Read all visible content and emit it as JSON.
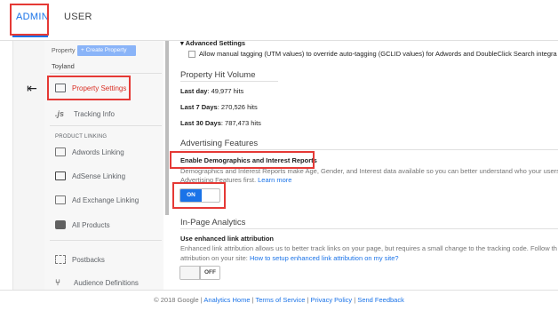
{
  "tabs": {
    "admin": "ADMIN",
    "user": "USER"
  },
  "property": {
    "label": "Property",
    "create_button": "+ Create Property",
    "name": "Toyland"
  },
  "nav": {
    "items": [
      {
        "label": "Property Settings",
        "icon": "property-settings-icon",
        "active": true
      },
      {
        "label": "Tracking Info",
        "icon": "js-icon",
        "active": false
      }
    ],
    "section_header": "PRODUCT LINKING",
    "linking": [
      {
        "label": "Adwords Linking",
        "icon": "adwords-icon"
      },
      {
        "label": "AdSense Linking",
        "icon": "adsense-icon"
      },
      {
        "label": "Ad Exchange Linking",
        "icon": "ad-exchange-icon"
      },
      {
        "label": "All Products",
        "icon": "all-products-icon"
      }
    ],
    "bottom": [
      {
        "label": "Postbacks",
        "icon": "postbacks-icon"
      },
      {
        "label": "Audience Definitions",
        "icon": "audience-icon"
      }
    ]
  },
  "main": {
    "advanced_settings": "▾ Advanced Settings",
    "manual_tagging": "Allow manual tagging (UTM values) to override auto-tagging (GCLID values) for Adwords and DoubleClick Search integra",
    "hit_volume": {
      "heading": "Property Hit Volume",
      "rows": [
        {
          "label": "Last day",
          "value": ": 49,977 hits"
        },
        {
          "label": "Last 7 Days",
          "value": ": 270,526 hits"
        },
        {
          "label": "Last 30 Days",
          "value": ": 787,473 hits"
        }
      ]
    },
    "advertising": {
      "heading": "Advertising Features",
      "enable_label": "Enable Demographics and Interest Reports",
      "description": "Demographics and Interest Reports make Age, Gender, and Interest data available so you can better understand who your users a",
      "description2": "Advertising Features first.",
      "learn_more": "Learn more",
      "toggle_on": "ON"
    },
    "in_page": {
      "heading": "In-Page Analytics",
      "enhanced_label": "Use enhanced link attribution",
      "description": "Enhanced link attribution allows us to better track links on your page, but requires a small change to the tracking code. Follow th",
      "description2": "attribution on your site:",
      "setup_link": "How to setup enhanced link attribution on my site?",
      "toggle_off": "OFF"
    }
  },
  "footer": {
    "copyright": "© 2018 Google |",
    "links": [
      "Analytics Home",
      "Terms of Service",
      "Privacy Policy",
      "Send Feedback"
    ]
  },
  "colors": {
    "accent": "#1a73e8",
    "highlight_box": "#e53935"
  }
}
